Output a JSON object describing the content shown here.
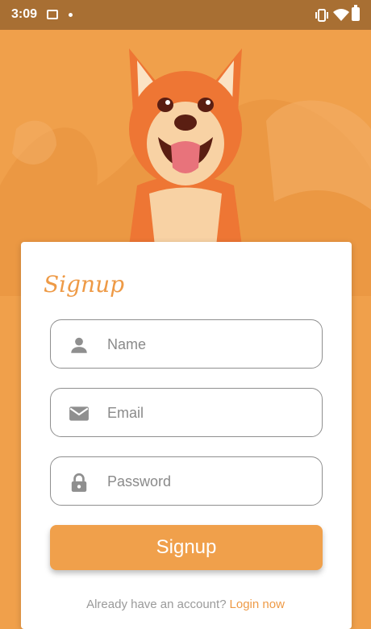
{
  "status_bar": {
    "time": "3:09"
  },
  "form": {
    "title": "Signup",
    "name_placeholder": "Name",
    "email_placeholder": "Email",
    "password_placeholder": "Password",
    "submit_label": "Signup"
  },
  "footer": {
    "prompt": "Already have an account?",
    "link": "Login now"
  },
  "colors": {
    "accent": "#F0A04B",
    "status_bar": "#A86F33",
    "background": "#F0A04B",
    "card": "#FFFFFF"
  },
  "icons": [
    "image-icon",
    "vibrate-icon",
    "wifi-icon",
    "battery-icon",
    "person-icon",
    "mail-icon",
    "lock-icon"
  ]
}
